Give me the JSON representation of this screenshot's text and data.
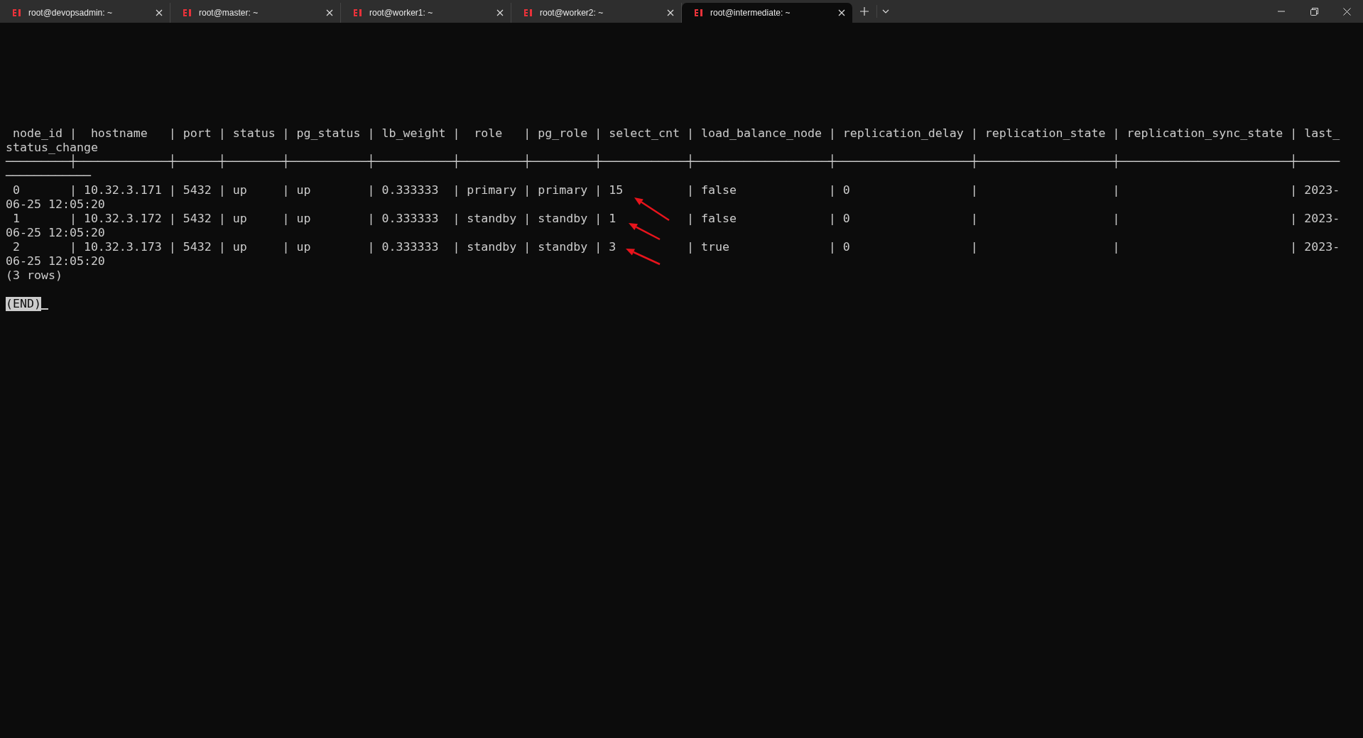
{
  "tabs": [
    {
      "title": "root@devopsadmin: ~",
      "selected": false
    },
    {
      "title": "root@master: ~",
      "selected": false
    },
    {
      "title": "root@worker1: ~",
      "selected": false
    },
    {
      "title": "root@worker2: ~",
      "selected": false
    },
    {
      "title": "root@intermediate: ~",
      "selected": true
    }
  ],
  "terminal": {
    "lines": [
      " node_id |  hostname   | port | status | pg_status | lb_weight |  role   | pg_role | select_cnt | load_balance_node | replication_delay | replication_state | replication_sync_state | last_",
      "status_change",
      "─────────┼─────────────┼──────┼────────┼───────────┼───────────┼─────────┼─────────┼────────────┼───────────────────┼───────────────────┼───────────────────┼────────────────────────┼──────",
      "────────────",
      " 0       | 10.32.3.171 | 5432 | up     | up        | 0.333333  | primary | primary | 15         | false             | 0                 |                   |                        | 2023-",
      "06-25 12:05:20",
      " 1       | 10.32.3.172 | 5432 | up     | up        | 0.333333  | standby | standby | 1          | false             | 0                 |                   |                        | 2023-",
      "06-25 12:05:20",
      " 2       | 10.32.3.173 | 5432 | up     | up        | 0.333333  | standby | standby | 3          | true              | 0                 |                   |                        | 2023-",
      "06-25 12:05:20",
      "(3 rows)"
    ],
    "pager_prompt": "(END)"
  }
}
